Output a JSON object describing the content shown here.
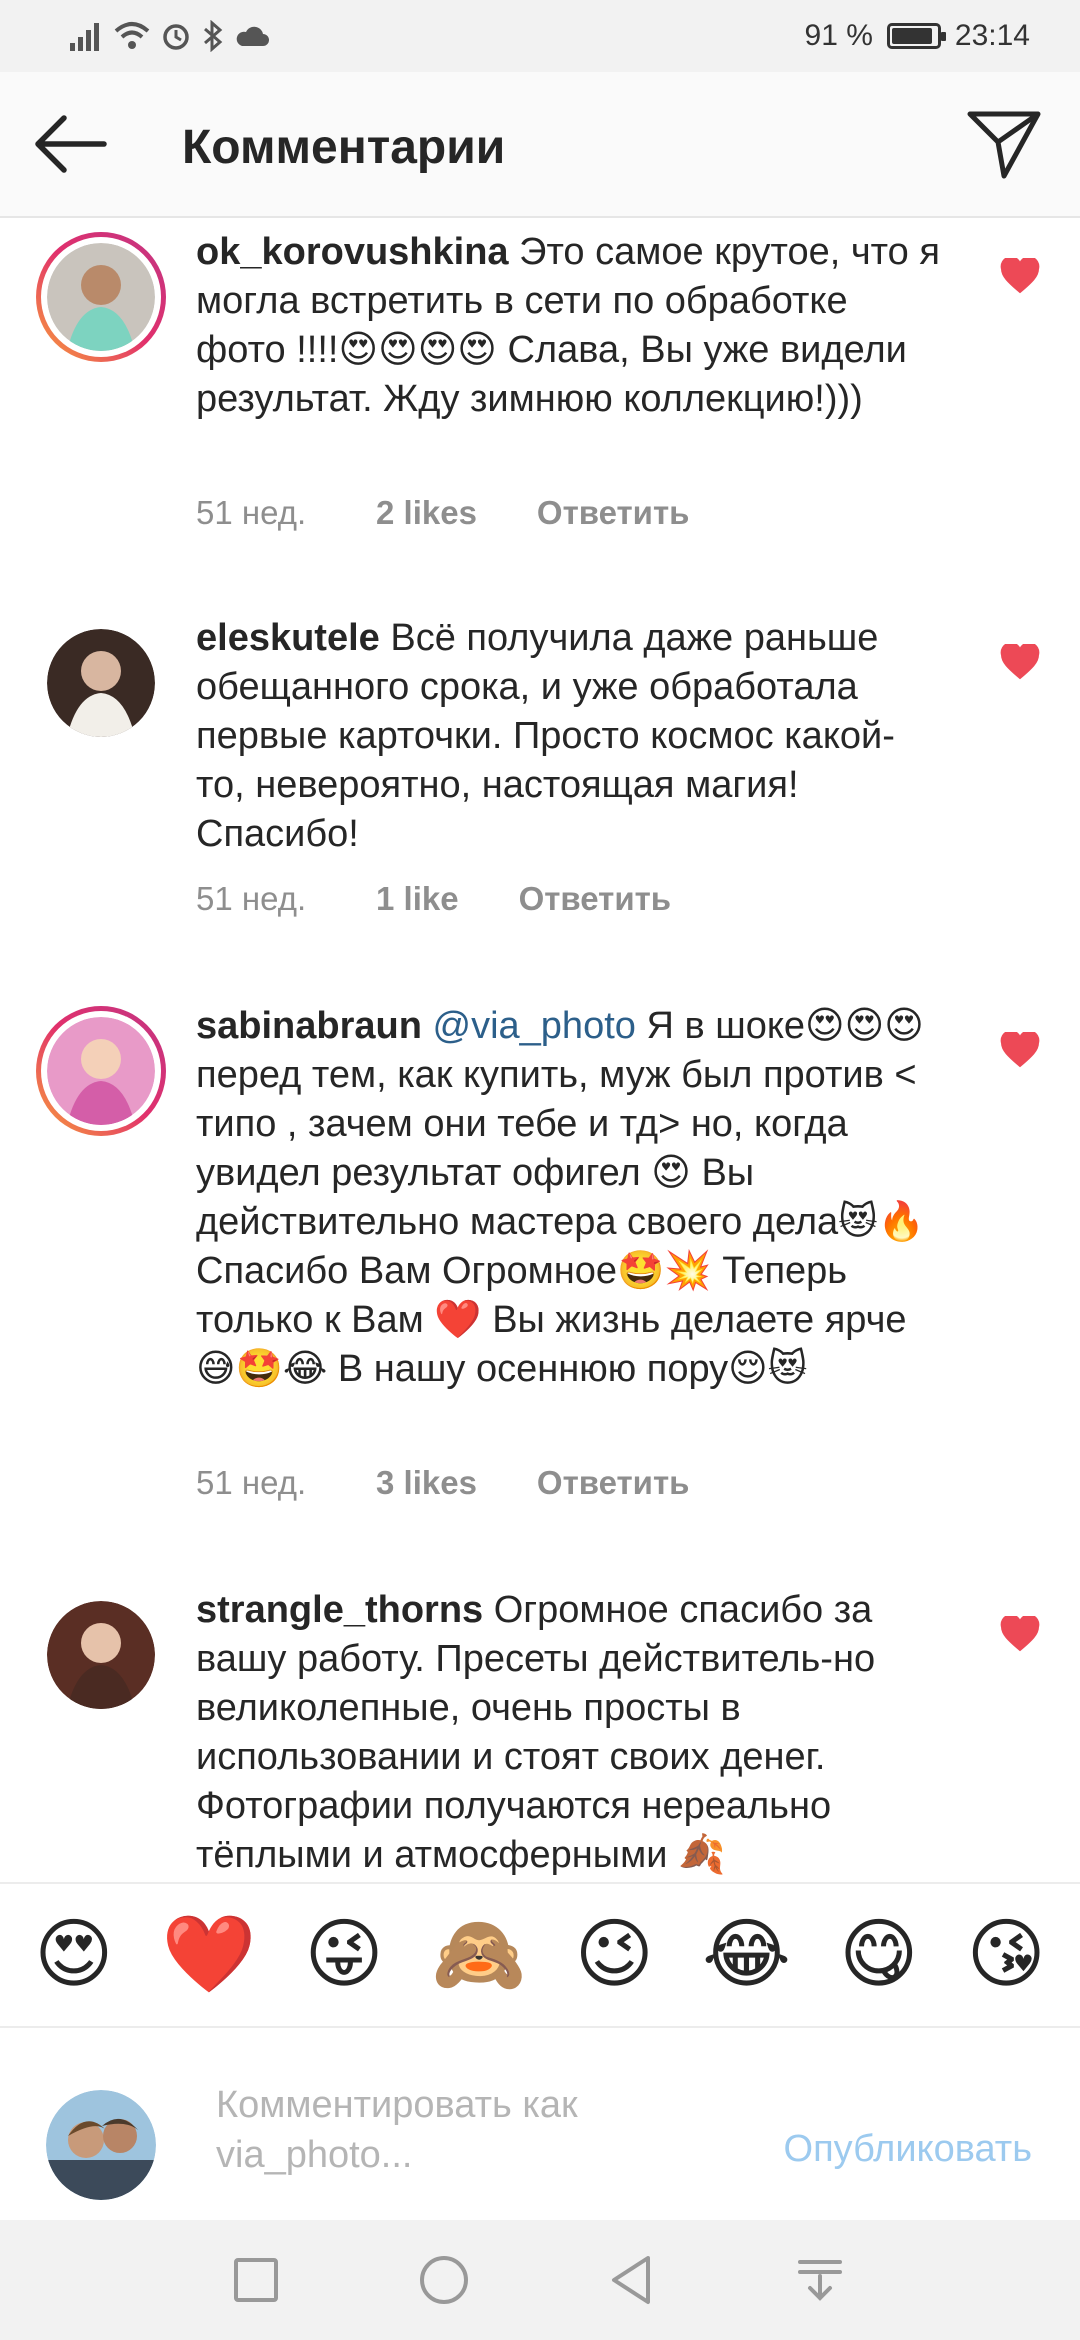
{
  "status_bar": {
    "battery_text": "91 %",
    "battery_level": 0.91,
    "time": "23:14"
  },
  "header": {
    "title": "Комментарии"
  },
  "comments": [
    {
      "username": "ok_korovushkina",
      "mention": "",
      "text": "Это самое крутое, что я могла встретить в сети по обработке фото !!!!😍😍😍😍 Слава, Вы уже видели результат. Жду зимнюю коллекцию!)))",
      "time": "51 нед.",
      "likes": "2 likes",
      "reply": "Ответить",
      "liked": true
    },
    {
      "username": "eleskutele",
      "mention": "",
      "text": "Всё получила даже раньше обещанного срока, и уже обработала первые карточки. Просто космос какой-то, невероятно, настоящая магия! Спасибо!",
      "time": "51 нед.",
      "likes": "1 like",
      "reply": "Ответить",
      "liked": true
    },
    {
      "username": "sabinabraun",
      "mention": "@via_photo",
      "text": "Я в шоке😍😍😍 перед тем, как купить, муж был против < типо , зачем они тебе и тд> но, когда увидел результат офигел 😍  Вы действительно мастера своего дела😻🔥 Спасибо Вам Огромное🤩💥 Теперь только к Вам ❤️ Вы жизнь делаете ярче😅🤩😂 В нашу осеннюю пору😌😻",
      "time": "51 нед.",
      "likes": "3 likes",
      "reply": "Ответить",
      "liked": true
    },
    {
      "username": "strangle_thorns",
      "mention": "",
      "text": "Огромное спасибо за вашу работу. Пресеты действитель-но великолепные, очень просты в использовании и стоят своих денег. Фотографии получаются нереально тёплыми и атмосферными 🍂",
      "time": "",
      "likes": "",
      "reply": "",
      "liked": true
    }
  ],
  "emoji_bar": [
    "😍",
    "❤️",
    "😜",
    "🙈",
    "😉",
    "😂",
    "😋",
    "😘"
  ],
  "composer": {
    "placeholder": "Комментировать как\nvia_photo...",
    "publish_label": "Опубликовать"
  },
  "colors": {
    "accent_blue_disabled": "#9ccaef",
    "heart_red": "#ed4956",
    "mention_blue": "#2c5f8a",
    "meta_gray": "#8e8e8e"
  }
}
